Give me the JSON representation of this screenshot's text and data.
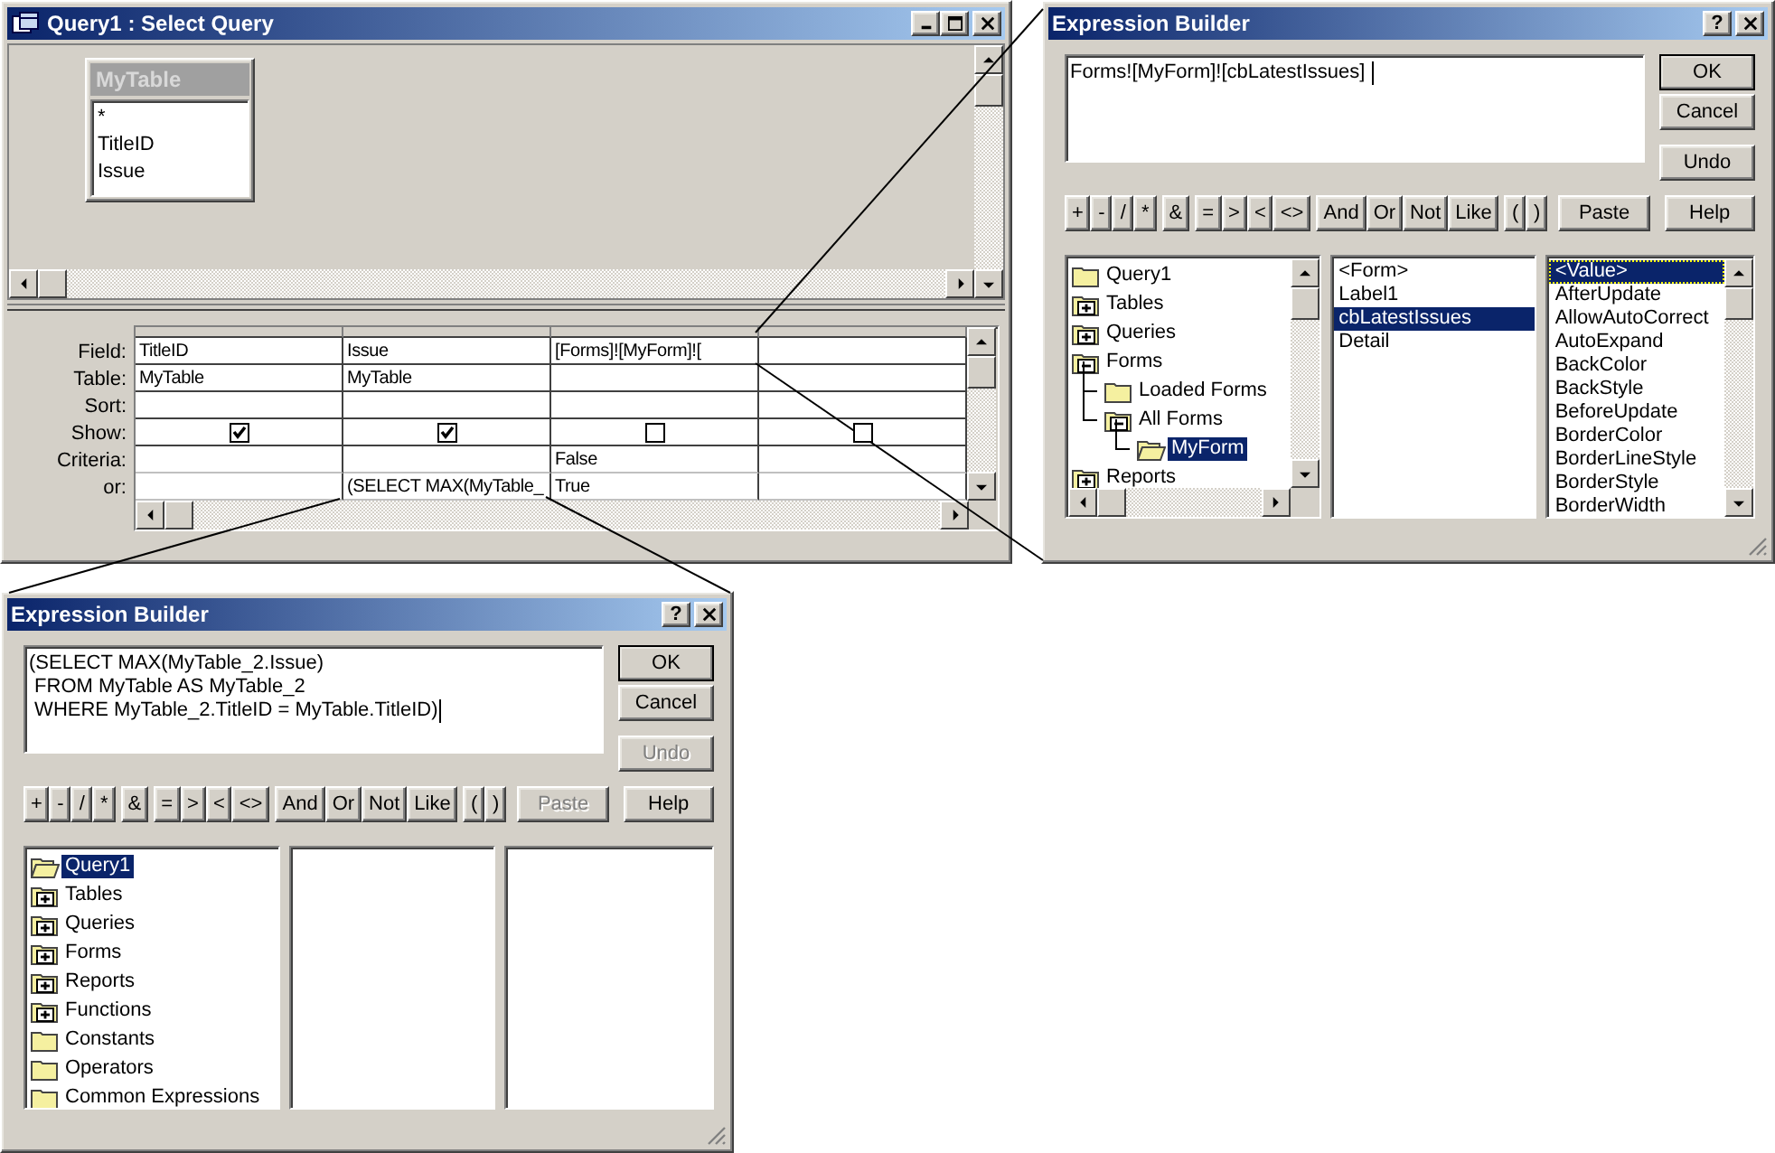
{
  "query_window": {
    "title": "Query1 : Select Query",
    "table_box": {
      "title": "MyTable",
      "fields": [
        "*",
        "TitleID",
        "Issue"
      ]
    },
    "grid": {
      "rows": [
        {
          "label": "Field:",
          "kind": "text",
          "cells": [
            "TitleID",
            "Issue",
            "[Forms]![MyForm]![",
            null
          ]
        },
        {
          "label": "Table:",
          "kind": "text",
          "cells": [
            "MyTable",
            "MyTable",
            null,
            null
          ]
        },
        {
          "label": "Sort:",
          "kind": "text",
          "cells": [
            null,
            null,
            null,
            null
          ]
        },
        {
          "label": "Show:",
          "kind": "checkbox",
          "cells": [
            {
              "checked": true
            },
            {
              "checked": true
            },
            {
              "checked": false
            },
            {
              "checked": false
            }
          ]
        },
        {
          "label": "Criteria:",
          "kind": "text",
          "cells": [
            null,
            null,
            "False",
            null
          ]
        },
        {
          "label": "or:",
          "kind": "text",
          "cells": [
            null,
            "(SELECT MAX(MyTable_",
            "True",
            null
          ]
        }
      ]
    }
  },
  "expression_builders": [
    {
      "title": "Expression Builder",
      "help_glyph": "?",
      "expression": [
        "Forms![MyForm]![cbLatestIssues] "
      ],
      "side_buttons": [
        {
          "label": "OK",
          "default": true,
          "disabled": false
        },
        {
          "label": "Cancel",
          "default": false,
          "disabled": false
        },
        {
          "label": "Undo",
          "default": false,
          "disabled": false
        }
      ],
      "operator_groups": [
        [
          "+",
          "-",
          "/",
          "*"
        ],
        [
          "&"
        ],
        [
          "=",
          ">",
          "<",
          "<>"
        ],
        [
          "And",
          "Or",
          "Not",
          "Like"
        ],
        [
          "(",
          ")"
        ]
      ],
      "bottom_buttons": [
        {
          "label": "Paste",
          "disabled": false
        },
        {
          "label": "Help",
          "disabled": false
        }
      ],
      "tree": {
        "items": [
          {
            "label": "Query1",
            "kind": "folder",
            "selected": false
          },
          {
            "label": "Tables",
            "kind": "plus",
            "selected": false
          },
          {
            "label": "Queries",
            "kind": "plus",
            "selected": false
          },
          {
            "label": "Forms",
            "kind": "minus",
            "selected": false,
            "children": [
              {
                "label": "Loaded Forms",
                "kind": "folder",
                "selected": false
              },
              {
                "label": "All Forms",
                "kind": "minus",
                "selected": false,
                "children": [
                  {
                    "label": "MyForm",
                    "kind": "open",
                    "selected": true
                  }
                ]
              }
            ]
          },
          {
            "label": "Reports",
            "kind": "plus",
            "selected": false
          }
        ]
      },
      "list_2": {
        "items": [
          {
            "label": "<Form>",
            "selected": false
          },
          {
            "label": "Label1",
            "selected": false
          },
          {
            "label": "cbLatestIssues",
            "selected": true
          },
          {
            "label": "Detail",
            "selected": false
          }
        ]
      },
      "list_3": {
        "items": [
          {
            "label": "<Value>",
            "selected": true
          },
          {
            "label": "AfterUpdate",
            "selected": false
          },
          {
            "label": "AllowAutoCorrect",
            "selected": false
          },
          {
            "label": "AutoExpand",
            "selected": false
          },
          {
            "label": "BackColor",
            "selected": false
          },
          {
            "label": "BackStyle",
            "selected": false
          },
          {
            "label": "BeforeUpdate",
            "selected": false
          },
          {
            "label": "BorderColor",
            "selected": false
          },
          {
            "label": "BorderLineStyle",
            "selected": false
          },
          {
            "label": "BorderStyle",
            "selected": false
          },
          {
            "label": "BorderWidth",
            "selected": false
          }
        ]
      }
    },
    {
      "title": "Expression Builder",
      "help_glyph": "?",
      "expression": [
        "(SELECT MAX(MyTable_2.Issue)",
        " FROM MyTable AS MyTable_2",
        " WHERE MyTable_2.TitleID = MyTable.TitleID)"
      ],
      "side_buttons": [
        {
          "label": "OK",
          "default": true,
          "disabled": false
        },
        {
          "label": "Cancel",
          "default": false,
          "disabled": false
        },
        {
          "label": "Undo",
          "default": false,
          "disabled": true
        }
      ],
      "operator_groups": [
        [
          "+",
          "-",
          "/",
          "*"
        ],
        [
          "&"
        ],
        [
          "=",
          ">",
          "<",
          "<>"
        ],
        [
          "And",
          "Or",
          "Not",
          "Like"
        ],
        [
          "(",
          ")"
        ]
      ],
      "bottom_buttons": [
        {
          "label": "Paste",
          "disabled": true
        },
        {
          "label": "Help",
          "disabled": false
        }
      ],
      "tree": {
        "items": [
          {
            "label": "Query1",
            "kind": "open",
            "selected": true
          },
          {
            "label": "Tables",
            "kind": "plus",
            "selected": false
          },
          {
            "label": "Queries",
            "kind": "plus",
            "selected": false
          },
          {
            "label": "Forms",
            "kind": "plus",
            "selected": false
          },
          {
            "label": "Reports",
            "kind": "plus",
            "selected": false
          },
          {
            "label": "Functions",
            "kind": "plus",
            "selected": false
          },
          {
            "label": "Constants",
            "kind": "folder",
            "selected": false
          },
          {
            "label": "Operators",
            "kind": "folder",
            "selected": false
          },
          {
            "label": "Common Expressions",
            "kind": "folder",
            "selected": false
          }
        ]
      }
    }
  ]
}
